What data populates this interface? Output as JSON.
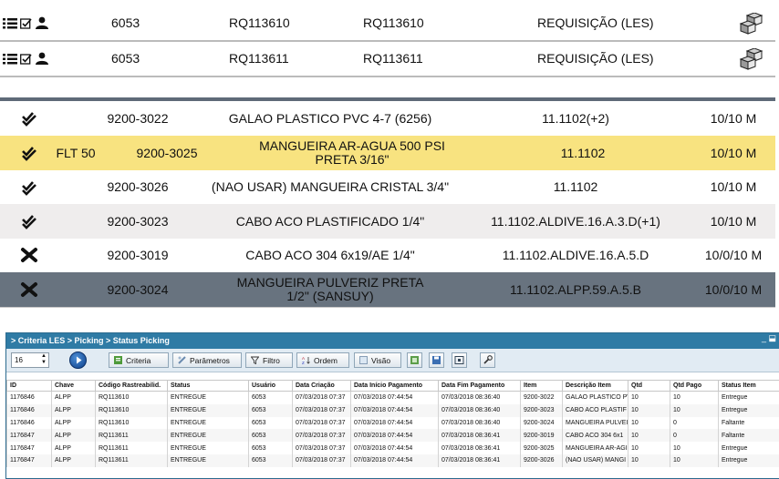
{
  "requisitions": [
    {
      "filial": "6053",
      "codigo": "RQ113610",
      "requisicao": "RQ113610",
      "tipo": "REQUISIÇÃO (LES)"
    },
    {
      "filial": "6053",
      "codigo": "RQ113611",
      "requisicao": "RQ113611",
      "tipo": "REQUISIÇÃO (LES)"
    }
  ],
  "items": [
    {
      "status_icon": "check-double-icon",
      "prefix": "",
      "codigo": "9200-3022",
      "descricao": [
        "GALAO PLASTICO PVC 4-7 (6256)"
      ],
      "endereco": "11.1102(+2)",
      "qtd": "10/10 M"
    },
    {
      "status_icon": "check-double-icon",
      "prefix": "FLT 50",
      "codigo": "9200-3025",
      "descricao": [
        "MANGUEIRA AR-AGUA 500 PSI",
        "PRETA 3/16\""
      ],
      "endereco": "11.1102",
      "qtd": "10/10 M"
    },
    {
      "status_icon": "check-double-icon",
      "prefix": "",
      "codigo": "9200-3026",
      "descricao": [
        "(NAO USAR) MANGUEIRA CRISTAL 3/4\""
      ],
      "endereco": "11.1102",
      "qtd": "10/10 M"
    },
    {
      "status_icon": "check-double-icon",
      "prefix": "",
      "codigo": "9200-3023",
      "descricao": [
        "CABO ACO PLASTIFICADO 1/4\""
      ],
      "endereco": "11.1102.ALDIVE.16.A.3.D(+1)",
      "qtd": "10/10 M"
    },
    {
      "status_icon": "x-icon",
      "prefix": "",
      "codigo": "9200-3019",
      "descricao": [
        "CABO ACO 304 6x19/AE 1/4\""
      ],
      "endereco": "11.1102.ALDIVE.16.A.5.D",
      "qtd": "10/0/10 M"
    },
    {
      "status_icon": "x-icon",
      "prefix": "",
      "codigo": "9200-3024",
      "descricao": [
        "MANGUEIRA PULVERIZ PRETA",
        "1/2\" (SANSUY)"
      ],
      "endereco": "11.1102.ALPP.59.A.5.B",
      "qtd": "10/0/10 M"
    }
  ],
  "window": {
    "breadcrumb": "> Criteria LES > Picking > Status Picking",
    "controls": "_ ⬓",
    "page_size": "16",
    "toolbar": {
      "criteria": "Criteria",
      "parametros": "Parâmetros",
      "filtro": "Filtro",
      "ordem": "Ordem",
      "visao": "Visão"
    },
    "columns": [
      "ID",
      "Chave",
      "Código Rastreabilid.",
      "Status",
      "Usuário",
      "Data Criação",
      "Data Início Pagamento",
      "Data Fim Pagamento",
      "Item",
      "Descrição Item",
      "Qtd",
      "Qtd Pago",
      "Status Item"
    ],
    "rows": [
      [
        "1176846",
        "ALPP",
        "RQ113610",
        "ENTREGUE",
        "6053",
        "07/03/2018 07:37",
        "07/03/2018 07:44:54",
        "07/03/2018 08:36:40",
        "9200-3022",
        "GALAO PLASTICO PV",
        "10",
        "10",
        "Entregue"
      ],
      [
        "1176846",
        "ALPP",
        "RQ113610",
        "ENTREGUE",
        "6053",
        "07/03/2018 07:37",
        "07/03/2018 07:44:54",
        "07/03/2018 08:36:40",
        "9200-3023",
        "CABO ACO PLASTIF",
        "10",
        "10",
        "Entregue"
      ],
      [
        "1176846",
        "ALPP",
        "RQ113610",
        "ENTREGUE",
        "6053",
        "07/03/2018 07:37",
        "07/03/2018 07:44:54",
        "07/03/2018 08:36:40",
        "9200-3024",
        "MANGUEIRA PULVEI",
        "10",
        "0",
        "Faltante"
      ],
      [
        "1176847",
        "ALPP",
        "RQ113611",
        "ENTREGUE",
        "6053",
        "07/03/2018 07:37",
        "07/03/2018 07:44:54",
        "07/03/2018 08:36:41",
        "9200-3019",
        "CABO ACO 304 6x1",
        "10",
        "0",
        "Faltante"
      ],
      [
        "1176847",
        "ALPP",
        "RQ113611",
        "ENTREGUE",
        "6053",
        "07/03/2018 07:37",
        "07/03/2018 07:44:54",
        "07/03/2018 08:36:41",
        "9200-3025",
        "MANGUEIRA AR-AGI",
        "10",
        "10",
        "Entregue"
      ],
      [
        "1176847",
        "ALPP",
        "RQ113611",
        "ENTREGUE",
        "6053",
        "07/03/2018 07:37",
        "07/03/2018 07:44:54",
        "07/03/2018 08:36:41",
        "9200-3026",
        "(NAO USAR) MANGI",
        "10",
        "10",
        "Entregue"
      ]
    ]
  }
}
